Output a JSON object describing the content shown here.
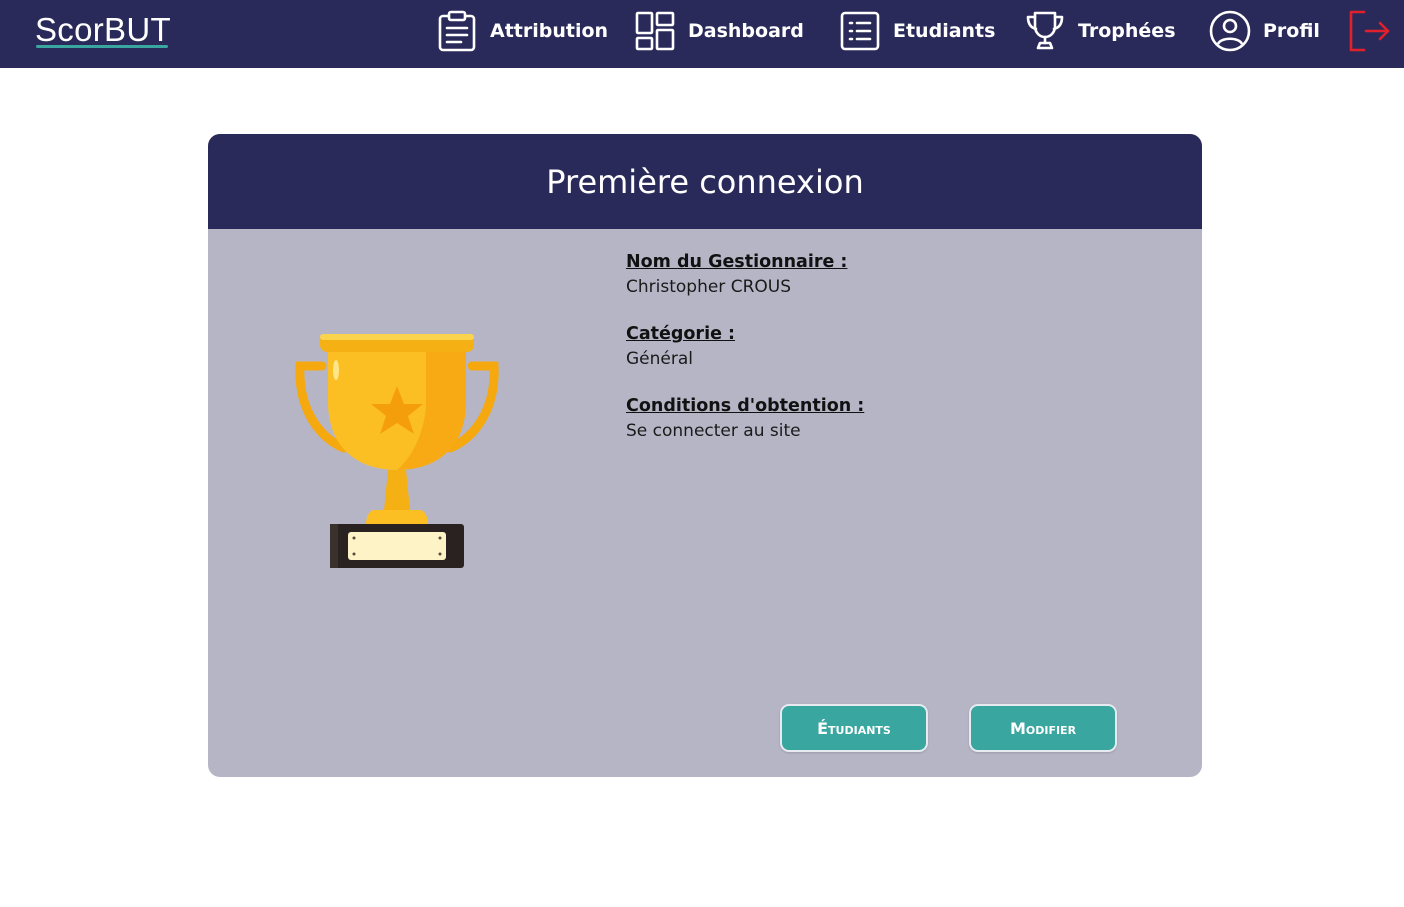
{
  "app": {
    "brand": "ScorBUT"
  },
  "nav": {
    "items": [
      {
        "label": "Attribution",
        "icon": "clipboard-icon"
      },
      {
        "label": "Dashboard",
        "icon": "dashboard-grid-icon"
      },
      {
        "label": "Etudiants",
        "icon": "list-icon"
      },
      {
        "label": "Trophées",
        "icon": "trophy-icon"
      },
      {
        "label": "Profil",
        "icon": "user-circle-icon"
      }
    ],
    "logout_icon": "logout-icon"
  },
  "card": {
    "title": "Première connexion",
    "fields": [
      {
        "label": "Nom du Gestionnaire :",
        "value": "Christopher CROUS"
      },
      {
        "label": "Catégorie :",
        "value": "Général"
      },
      {
        "label": "Conditions d'obtention :",
        "value": "Se connecter au site"
      }
    ],
    "buttons": {
      "students": "Étudiants",
      "edit": "Modifier"
    }
  },
  "colors": {
    "navbar": "#2a2a5a",
    "card_body": "#b6b5c6",
    "accent": "#3aa6a0",
    "logout": "#e0202a",
    "trophy_gold": "#fbbf24"
  }
}
